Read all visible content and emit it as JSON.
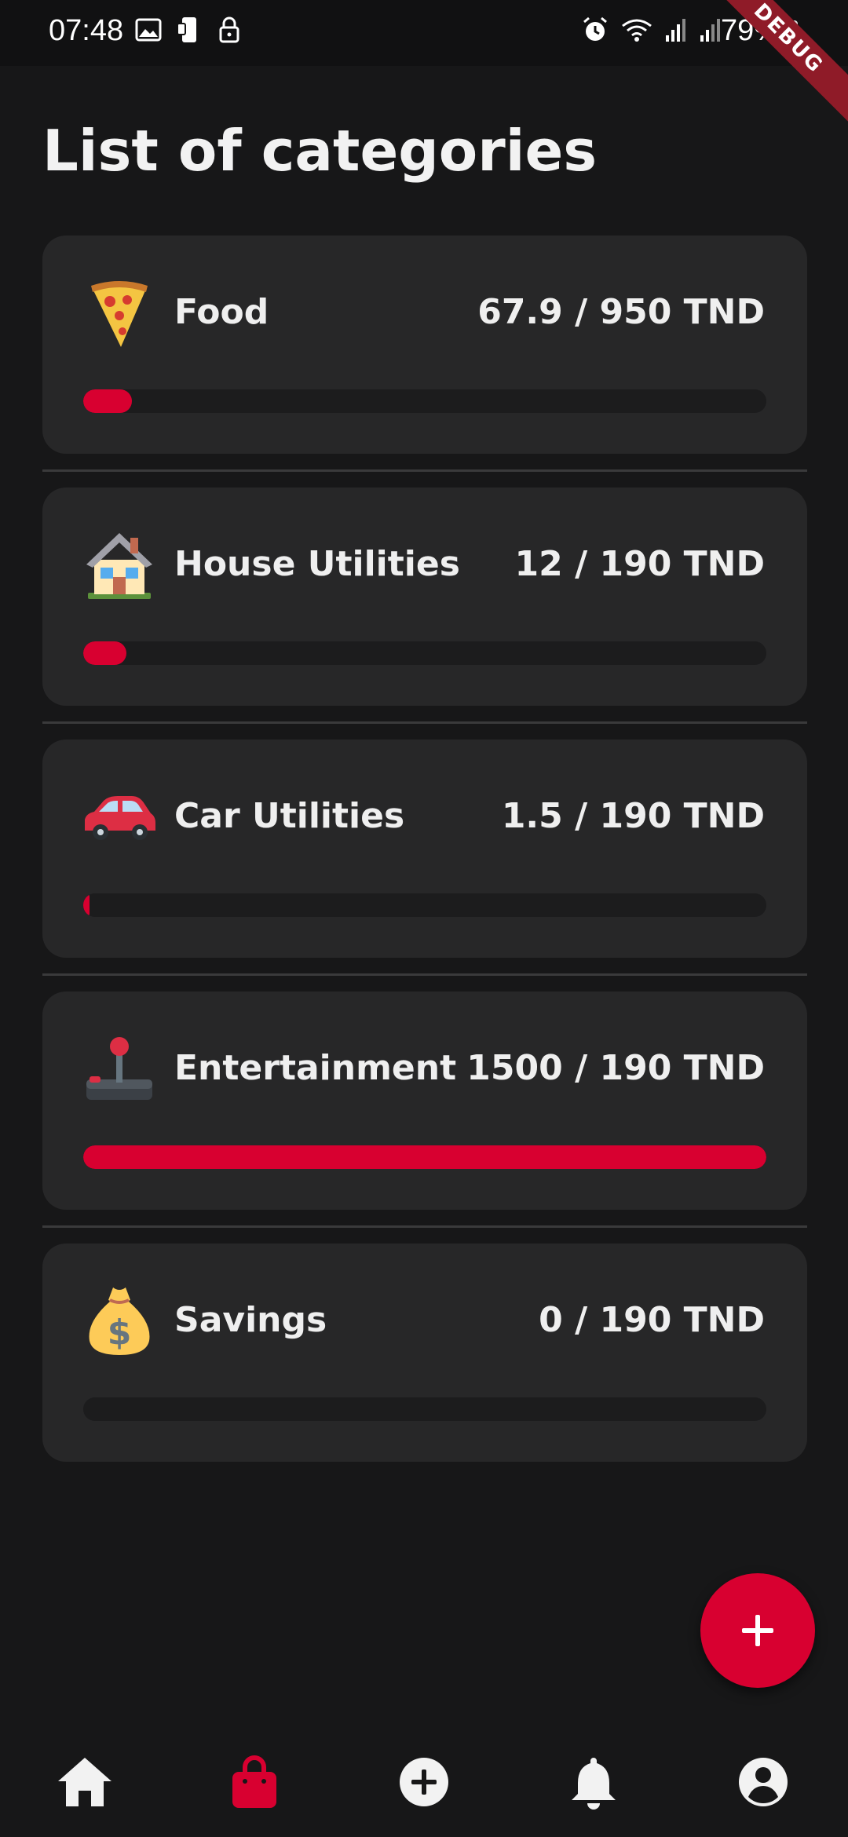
{
  "status_bar": {
    "time": "07:48",
    "battery": "79%",
    "left_icons": [
      "image-icon",
      "phone-sync-icon",
      "lock-icon"
    ],
    "right_icons": [
      "alarm-icon",
      "wifi-icon",
      "signal-icon",
      "signal-icon",
      "battery-icon"
    ]
  },
  "debug_banner": "DEBUG",
  "page": {
    "title": "List of categories"
  },
  "categories": [
    {
      "icon": "pizza-icon",
      "name": "Food",
      "amount": "67.9 / 950 TND",
      "spent": 67.9,
      "budget": 950
    },
    {
      "icon": "house-icon",
      "name": "House Utilities",
      "amount": "12 / 190 TND",
      "spent": 12,
      "budget": 190
    },
    {
      "icon": "car-icon",
      "name": "Car Utilities",
      "amount": "1.5 / 190 TND",
      "spent": 1.5,
      "budget": 190
    },
    {
      "icon": "joystick-icon",
      "name": "Entertainment",
      "amount": "1500 / 190 TND",
      "spent": 1500,
      "budget": 190
    },
    {
      "icon": "money-bag-icon",
      "name": "Savings",
      "amount": "0 / 190 TND",
      "spent": 0,
      "budget": 190
    }
  ],
  "fab": {
    "icon": "plus-icon"
  },
  "bottom_nav": {
    "items": [
      {
        "icon": "home-icon",
        "active": false
      },
      {
        "icon": "shopping-bag-icon",
        "active": true
      },
      {
        "icon": "add-circle-icon",
        "active": false
      },
      {
        "icon": "bell-icon",
        "active": false
      },
      {
        "icon": "account-circle-icon",
        "active": false
      }
    ]
  },
  "colors": {
    "accent": "#d80030",
    "background": "#171718",
    "card": "#272728",
    "track": "#1c1c1d",
    "text": "#ececec"
  }
}
